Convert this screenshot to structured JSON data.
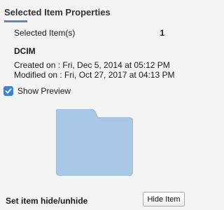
{
  "panel": {
    "title": "Selected Item Properties",
    "accent_color": "#5b8bb5"
  },
  "selection": {
    "label": "Selected Item(s)",
    "count": "1",
    "item_name": "DCIM",
    "created": "Created on : Fri, Dec 5, 2014 at 05:12 PM",
    "modified": "Modified on : Fri, Oct 27, 2017 at 04:13 PM"
  },
  "preview": {
    "label": "Show Preview",
    "checked": true,
    "checkbox_color": "#3f82d8",
    "icon": "folder-icon",
    "folder_color": "#a9c7e6"
  },
  "visibility": {
    "label": "Set item hide/unhide",
    "button_label": "Hide Item"
  }
}
